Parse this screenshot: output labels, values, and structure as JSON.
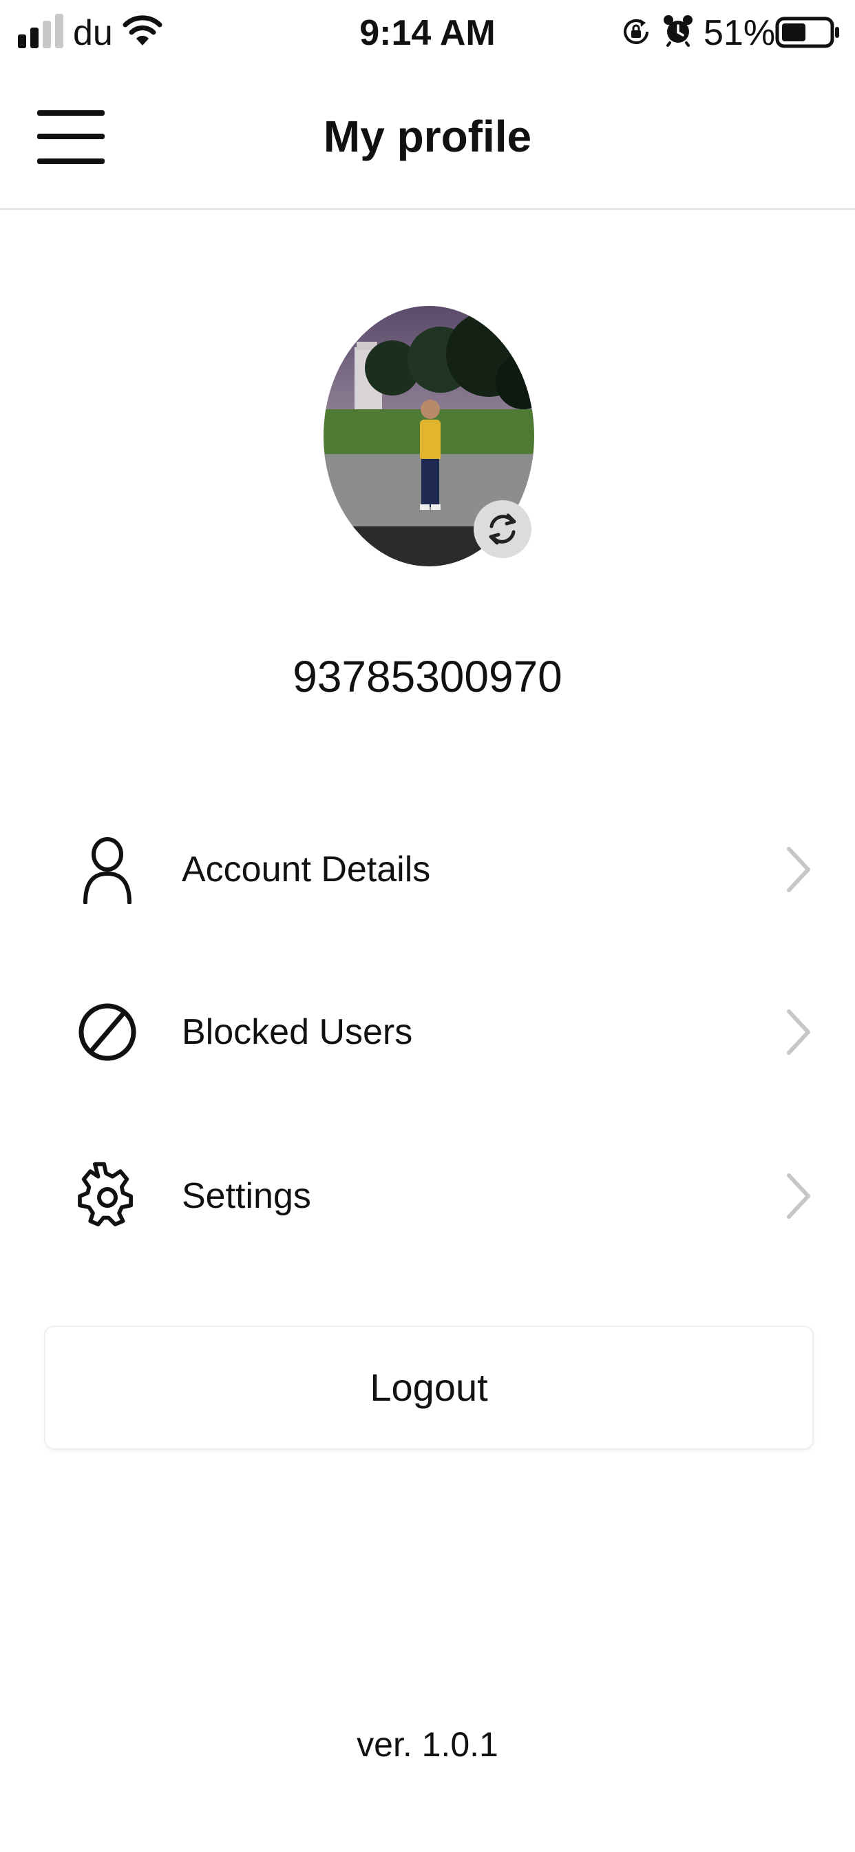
{
  "status_bar": {
    "carrier": "du",
    "time": "9:14 AM",
    "battery_percent": "51%",
    "battery_level": 0.51,
    "signal_bars_filled": 2,
    "signal_bars_total": 4,
    "icons": [
      "signal-icon",
      "wifi-icon",
      "orientation-lock-icon",
      "alarm-icon",
      "battery-icon"
    ]
  },
  "header": {
    "title": "My profile",
    "menu_icon": "hamburger-menu-icon"
  },
  "profile": {
    "phone_number": "93785300970",
    "avatar_icon": "avatar",
    "change_photo_icon": "refresh-icon"
  },
  "menu": {
    "items": [
      {
        "label": "Account Details",
        "icon": "person-icon"
      },
      {
        "label": "Blocked Users",
        "icon": "block-icon"
      },
      {
        "label": "Settings",
        "icon": "gear-icon"
      }
    ],
    "chevron_icon": "chevron-right-icon"
  },
  "logout": {
    "label": "Logout"
  },
  "footer": {
    "version": "ver. 1.0.1"
  },
  "colors": {
    "text": "#111111",
    "background": "#ffffff",
    "divider": "#e6e6e6",
    "chevron": "#c7c7c7",
    "refresh_badge": "#dcdcdc"
  }
}
